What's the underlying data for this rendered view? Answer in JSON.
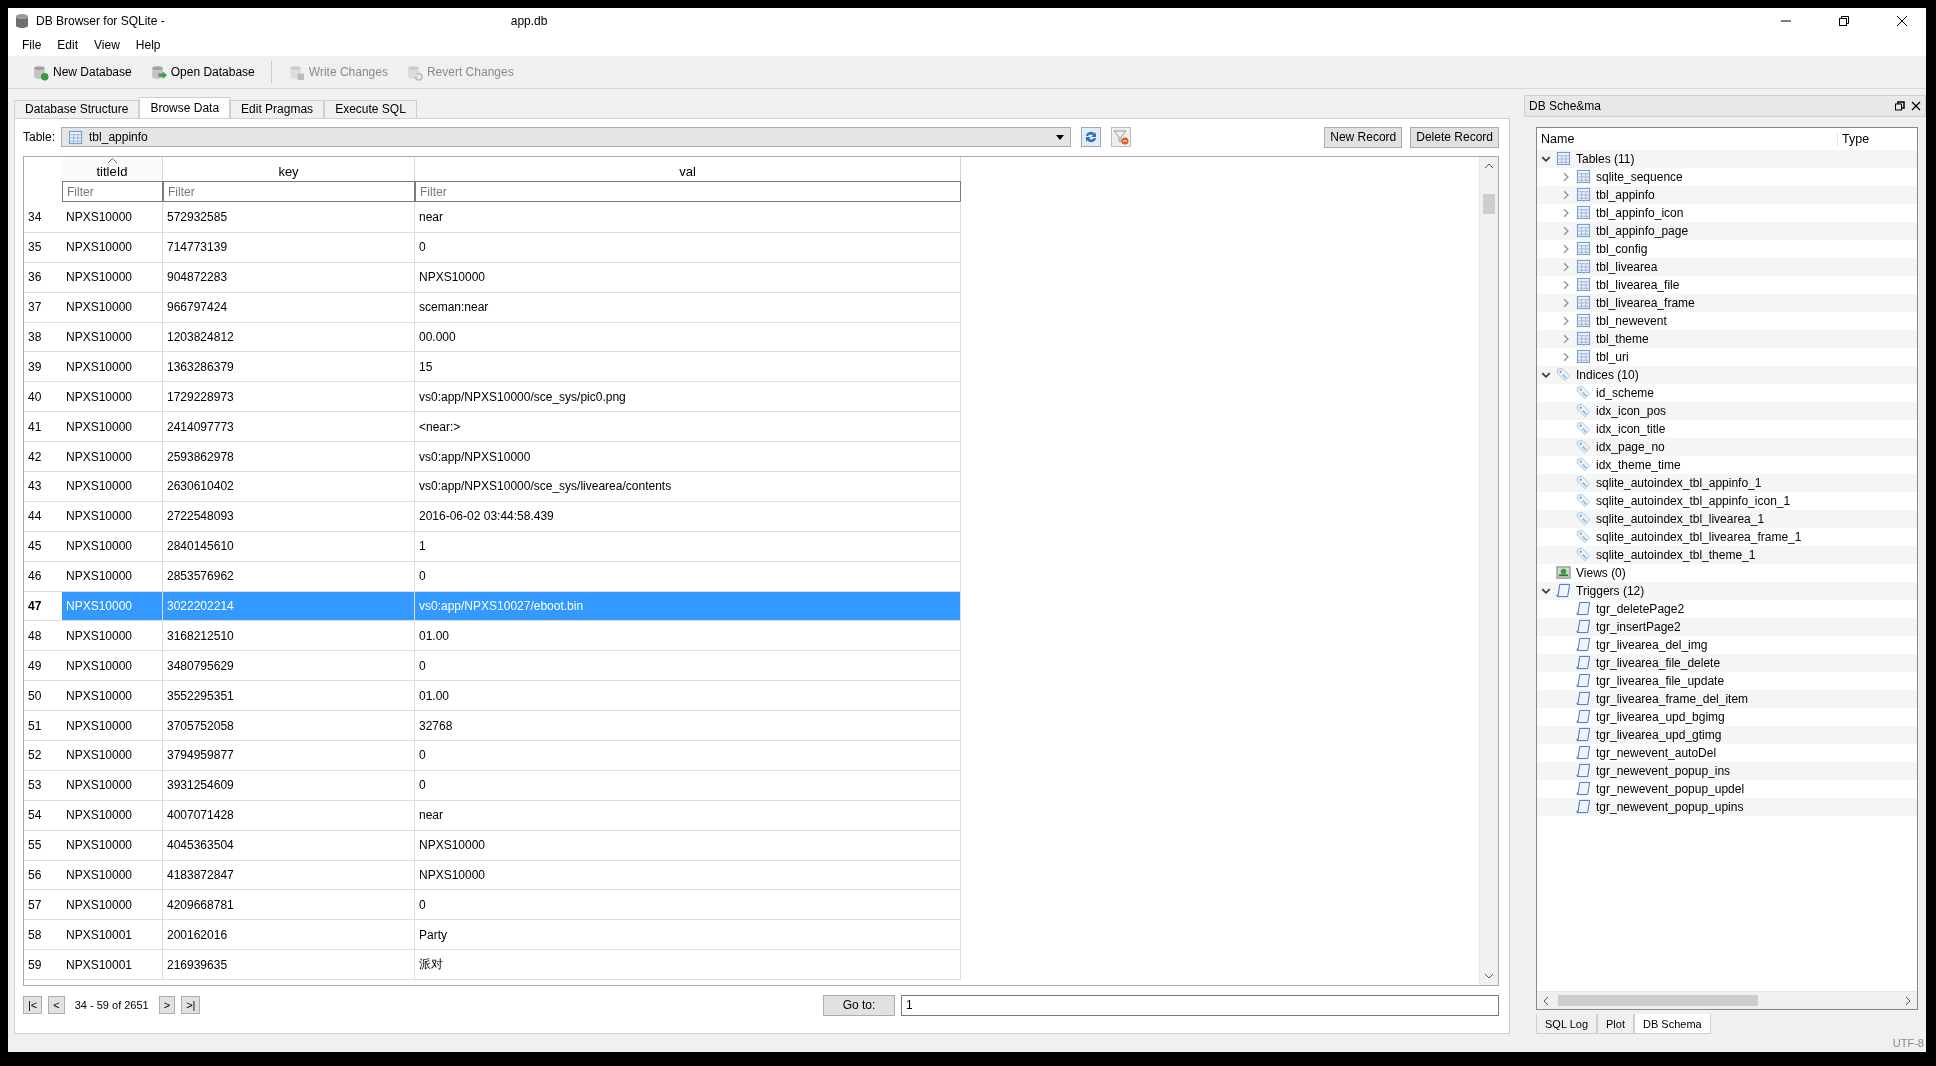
{
  "window": {
    "title": "DB Browser for SQLite -",
    "title_suffix": "app.db"
  },
  "menu": [
    "File",
    "Edit",
    "View",
    "Help"
  ],
  "toolbar": [
    {
      "label": "New Database",
      "kind": "new",
      "disabled": false
    },
    {
      "label": "Open Database",
      "kind": "open",
      "disabled": false
    },
    {
      "label": "Write Changes",
      "kind": "write",
      "disabled": true
    },
    {
      "label": "Revert Changes",
      "kind": "revert",
      "disabled": true
    }
  ],
  "tabs": [
    {
      "label": "Database Structure",
      "selected": false
    },
    {
      "label": "Browse Data",
      "selected": true
    },
    {
      "label": "Edit Pragmas",
      "selected": false
    },
    {
      "label": "Execute SQL",
      "selected": false
    }
  ],
  "table_selector": {
    "label": "Table:",
    "value": "tbl_appinfo"
  },
  "record_buttons": [
    "New Record",
    "Delete Record"
  ],
  "grid": {
    "columns": [
      {
        "name": "titleId",
        "sorted": true,
        "placeholder": "Filter"
      },
      {
        "name": "key",
        "sorted": false,
        "placeholder": "Filter"
      },
      {
        "name": "val",
        "sorted": false,
        "placeholder": "Filter"
      }
    ],
    "rows": [
      {
        "num": "34",
        "cells": [
          "NPXS10000",
          "572932585",
          "near"
        ],
        "selected": false
      },
      {
        "num": "35",
        "cells": [
          "NPXS10000",
          "714773139",
          "0"
        ],
        "selected": false
      },
      {
        "num": "36",
        "cells": [
          "NPXS10000",
          "904872283",
          "NPXS10000"
        ],
        "selected": false
      },
      {
        "num": "37",
        "cells": [
          "NPXS10000",
          "966797424",
          "sceman:near"
        ],
        "selected": false
      },
      {
        "num": "38",
        "cells": [
          "NPXS10000",
          "1203824812",
          "00.000"
        ],
        "selected": false
      },
      {
        "num": "39",
        "cells": [
          "NPXS10000",
          "1363286379",
          "15"
        ],
        "selected": false
      },
      {
        "num": "40",
        "cells": [
          "NPXS10000",
          "1729228973",
          "vs0:app/NPXS10000/sce_sys/pic0.png"
        ],
        "selected": false
      },
      {
        "num": "41",
        "cells": [
          "NPXS10000",
          "2414097773",
          "<near:>"
        ],
        "selected": false
      },
      {
        "num": "42",
        "cells": [
          "NPXS10000",
          "2593862978",
          "vs0:app/NPXS10000"
        ],
        "selected": false
      },
      {
        "num": "43",
        "cells": [
          "NPXS10000",
          "2630610402",
          "vs0:app/NPXS10000/sce_sys/livearea/contents"
        ],
        "selected": false
      },
      {
        "num": "44",
        "cells": [
          "NPXS10000",
          "2722548093",
          "2016-06-02 03:44:58.439"
        ],
        "selected": false
      },
      {
        "num": "45",
        "cells": [
          "NPXS10000",
          "2840145610",
          "1"
        ],
        "selected": false
      },
      {
        "num": "46",
        "cells": [
          "NPXS10000",
          "2853576962",
          "0"
        ],
        "selected": false
      },
      {
        "num": "47",
        "cells": [
          "NPXS10000",
          "3022202214",
          "vs0:app/NPXS10027/eboot.bin"
        ],
        "selected": true
      },
      {
        "num": "48",
        "cells": [
          "NPXS10000",
          "3168212510",
          "01.00"
        ],
        "selected": false
      },
      {
        "num": "49",
        "cells": [
          "NPXS10000",
          "3480795629",
          "0"
        ],
        "selected": false
      },
      {
        "num": "50",
        "cells": [
          "NPXS10000",
          "3552295351",
          "01.00"
        ],
        "selected": false
      },
      {
        "num": "51",
        "cells": [
          "NPXS10000",
          "3705752058",
          "32768"
        ],
        "selected": false
      },
      {
        "num": "52",
        "cells": [
          "NPXS10000",
          "3794959877",
          "0"
        ],
        "selected": false
      },
      {
        "num": "53",
        "cells": [
          "NPXS10000",
          "3931254609",
          "0"
        ],
        "selected": false
      },
      {
        "num": "54",
        "cells": [
          "NPXS10000",
          "4007071428",
          "near"
        ],
        "selected": false
      },
      {
        "num": "55",
        "cells": [
          "NPXS10000",
          "4045363504",
          "NPXS10000"
        ],
        "selected": false
      },
      {
        "num": "56",
        "cells": [
          "NPXS10000",
          "4183872847",
          "NPXS10000"
        ],
        "selected": false
      },
      {
        "num": "57",
        "cells": [
          "NPXS10000",
          "4209668781",
          "0"
        ],
        "selected": false
      },
      {
        "num": "58",
        "cells": [
          "NPXS10001",
          "200162016",
          "Party"
        ],
        "selected": false
      },
      {
        "num": "59",
        "cells": [
          "NPXS10001",
          "216939635",
          "派对"
        ],
        "selected": false
      }
    ]
  },
  "navigation": {
    "buttons": [
      "|<",
      "<",
      ">",
      ">|"
    ],
    "range": "34 - 59 of 2651",
    "goto_label": "Go to:",
    "goto_value": "1"
  },
  "schema_panel": {
    "title": "DB Sche&ma",
    "columns": [
      "Name",
      "Type"
    ],
    "tree": [
      {
        "label": "Tables (11)",
        "kind": "tables",
        "expanded": true,
        "children": [
          {
            "label": "sqlite_sequence",
            "kind": "table",
            "expanded": false
          },
          {
            "label": "tbl_appinfo",
            "kind": "table",
            "expanded": false
          },
          {
            "label": "tbl_appinfo_icon",
            "kind": "table",
            "expanded": false
          },
          {
            "label": "tbl_appinfo_page",
            "kind": "table",
            "expanded": false
          },
          {
            "label": "tbl_config",
            "kind": "table",
            "expanded": false
          },
          {
            "label": "tbl_livearea",
            "kind": "table",
            "expanded": false
          },
          {
            "label": "tbl_livearea_file",
            "kind": "table",
            "expanded": false
          },
          {
            "label": "tbl_livearea_frame",
            "kind": "table",
            "expanded": false
          },
          {
            "label": "tbl_newevent",
            "kind": "table",
            "expanded": false
          },
          {
            "label": "tbl_theme",
            "kind": "table",
            "expanded": false
          },
          {
            "label": "tbl_uri",
            "kind": "table",
            "expanded": false
          }
        ]
      },
      {
        "label": "Indices (10)",
        "kind": "index",
        "expanded": true,
        "children": [
          {
            "label": "id_scheme",
            "kind": "index"
          },
          {
            "label": "idx_icon_pos",
            "kind": "index"
          },
          {
            "label": "idx_icon_title",
            "kind": "index"
          },
          {
            "label": "idx_page_no",
            "kind": "index"
          },
          {
            "label": "idx_theme_time",
            "kind": "index"
          },
          {
            "label": "sqlite_autoindex_tbl_appinfo_1",
            "kind": "index"
          },
          {
            "label": "sqlite_autoindex_tbl_appinfo_icon_1",
            "kind": "index"
          },
          {
            "label": "sqlite_autoindex_tbl_livearea_1",
            "kind": "index"
          },
          {
            "label": "sqlite_autoindex_tbl_livearea_frame_1",
            "kind": "index"
          },
          {
            "label": "sqlite_autoindex_tbl_theme_1",
            "kind": "index"
          }
        ]
      },
      {
        "label": "Views (0)",
        "kind": "view"
      },
      {
        "label": "Triggers (12)",
        "kind": "trigger",
        "expanded": true,
        "children": [
          {
            "label": "tgr_deletePage2",
            "kind": "trigger"
          },
          {
            "label": "tgr_insertPage2",
            "kind": "trigger"
          },
          {
            "label": "tgr_livearea_del_img",
            "kind": "trigger"
          },
          {
            "label": "tgr_livearea_file_delete",
            "kind": "trigger"
          },
          {
            "label": "tgr_livearea_file_update",
            "kind": "trigger"
          },
          {
            "label": "tgr_livearea_frame_del_item",
            "kind": "trigger"
          },
          {
            "label": "tgr_livearea_upd_bgimg",
            "kind": "trigger"
          },
          {
            "label": "tgr_livearea_upd_gtimg",
            "kind": "trigger"
          },
          {
            "label": "tgr_newevent_autoDel",
            "kind": "trigger"
          },
          {
            "label": "tgr_newevent_popup_ins",
            "kind": "trigger"
          },
          {
            "label": "tgr_newevent_popup_updel",
            "kind": "trigger"
          },
          {
            "label": "tgr_newevent_popup_upins",
            "kind": "trigger"
          }
        ]
      }
    ]
  },
  "dock_tabs": [
    {
      "label": "SQL Log",
      "selected": false
    },
    {
      "label": "Plot",
      "selected": false
    },
    {
      "label": "DB Schema",
      "selected": true
    }
  ],
  "status_bar": {
    "encoding": "UTF-8"
  }
}
